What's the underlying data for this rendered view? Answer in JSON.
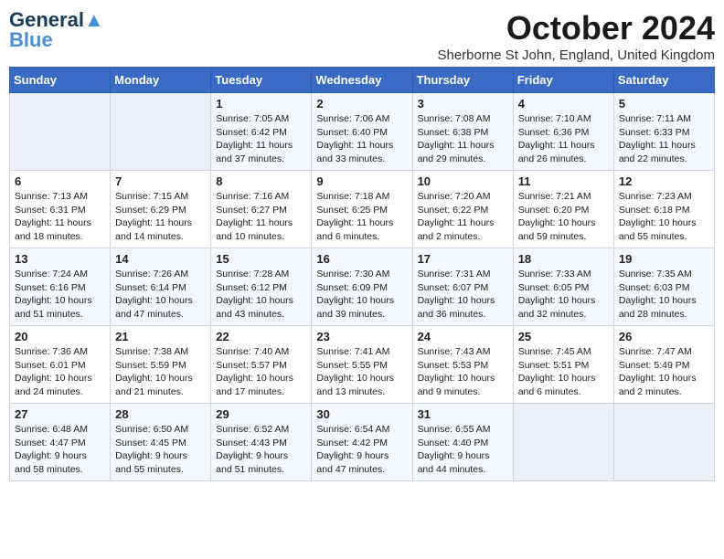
{
  "logo": {
    "line1": "General",
    "line2": "Blue"
  },
  "title": "October 2024",
  "location": "Sherborne St John, England, United Kingdom",
  "days_of_week": [
    "Sunday",
    "Monday",
    "Tuesday",
    "Wednesday",
    "Thursday",
    "Friday",
    "Saturday"
  ],
  "weeks": [
    [
      {
        "day": "",
        "content": ""
      },
      {
        "day": "",
        "content": ""
      },
      {
        "day": "1",
        "content": "Sunrise: 7:05 AM\nSunset: 6:42 PM\nDaylight: 11 hours and 37 minutes."
      },
      {
        "day": "2",
        "content": "Sunrise: 7:06 AM\nSunset: 6:40 PM\nDaylight: 11 hours and 33 minutes."
      },
      {
        "day": "3",
        "content": "Sunrise: 7:08 AM\nSunset: 6:38 PM\nDaylight: 11 hours and 29 minutes."
      },
      {
        "day": "4",
        "content": "Sunrise: 7:10 AM\nSunset: 6:36 PM\nDaylight: 11 hours and 26 minutes."
      },
      {
        "day": "5",
        "content": "Sunrise: 7:11 AM\nSunset: 6:33 PM\nDaylight: 11 hours and 22 minutes."
      }
    ],
    [
      {
        "day": "6",
        "content": "Sunrise: 7:13 AM\nSunset: 6:31 PM\nDaylight: 11 hours and 18 minutes."
      },
      {
        "day": "7",
        "content": "Sunrise: 7:15 AM\nSunset: 6:29 PM\nDaylight: 11 hours and 14 minutes."
      },
      {
        "day": "8",
        "content": "Sunrise: 7:16 AM\nSunset: 6:27 PM\nDaylight: 11 hours and 10 minutes."
      },
      {
        "day": "9",
        "content": "Sunrise: 7:18 AM\nSunset: 6:25 PM\nDaylight: 11 hours and 6 minutes."
      },
      {
        "day": "10",
        "content": "Sunrise: 7:20 AM\nSunset: 6:22 PM\nDaylight: 11 hours and 2 minutes."
      },
      {
        "day": "11",
        "content": "Sunrise: 7:21 AM\nSunset: 6:20 PM\nDaylight: 10 hours and 59 minutes."
      },
      {
        "day": "12",
        "content": "Sunrise: 7:23 AM\nSunset: 6:18 PM\nDaylight: 10 hours and 55 minutes."
      }
    ],
    [
      {
        "day": "13",
        "content": "Sunrise: 7:24 AM\nSunset: 6:16 PM\nDaylight: 10 hours and 51 minutes."
      },
      {
        "day": "14",
        "content": "Sunrise: 7:26 AM\nSunset: 6:14 PM\nDaylight: 10 hours and 47 minutes."
      },
      {
        "day": "15",
        "content": "Sunrise: 7:28 AM\nSunset: 6:12 PM\nDaylight: 10 hours and 43 minutes."
      },
      {
        "day": "16",
        "content": "Sunrise: 7:30 AM\nSunset: 6:09 PM\nDaylight: 10 hours and 39 minutes."
      },
      {
        "day": "17",
        "content": "Sunrise: 7:31 AM\nSunset: 6:07 PM\nDaylight: 10 hours and 36 minutes."
      },
      {
        "day": "18",
        "content": "Sunrise: 7:33 AM\nSunset: 6:05 PM\nDaylight: 10 hours and 32 minutes."
      },
      {
        "day": "19",
        "content": "Sunrise: 7:35 AM\nSunset: 6:03 PM\nDaylight: 10 hours and 28 minutes."
      }
    ],
    [
      {
        "day": "20",
        "content": "Sunrise: 7:36 AM\nSunset: 6:01 PM\nDaylight: 10 hours and 24 minutes."
      },
      {
        "day": "21",
        "content": "Sunrise: 7:38 AM\nSunset: 5:59 PM\nDaylight: 10 hours and 21 minutes."
      },
      {
        "day": "22",
        "content": "Sunrise: 7:40 AM\nSunset: 5:57 PM\nDaylight: 10 hours and 17 minutes."
      },
      {
        "day": "23",
        "content": "Sunrise: 7:41 AM\nSunset: 5:55 PM\nDaylight: 10 hours and 13 minutes."
      },
      {
        "day": "24",
        "content": "Sunrise: 7:43 AM\nSunset: 5:53 PM\nDaylight: 10 hours and 9 minutes."
      },
      {
        "day": "25",
        "content": "Sunrise: 7:45 AM\nSunset: 5:51 PM\nDaylight: 10 hours and 6 minutes."
      },
      {
        "day": "26",
        "content": "Sunrise: 7:47 AM\nSunset: 5:49 PM\nDaylight: 10 hours and 2 minutes."
      }
    ],
    [
      {
        "day": "27",
        "content": "Sunrise: 6:48 AM\nSunset: 4:47 PM\nDaylight: 9 hours and 58 minutes."
      },
      {
        "day": "28",
        "content": "Sunrise: 6:50 AM\nSunset: 4:45 PM\nDaylight: 9 hours and 55 minutes."
      },
      {
        "day": "29",
        "content": "Sunrise: 6:52 AM\nSunset: 4:43 PM\nDaylight: 9 hours and 51 minutes."
      },
      {
        "day": "30",
        "content": "Sunrise: 6:54 AM\nSunset: 4:42 PM\nDaylight: 9 hours and 47 minutes."
      },
      {
        "day": "31",
        "content": "Sunrise: 6:55 AM\nSunset: 4:40 PM\nDaylight: 9 hours and 44 minutes."
      },
      {
        "day": "",
        "content": ""
      },
      {
        "day": "",
        "content": ""
      }
    ]
  ]
}
